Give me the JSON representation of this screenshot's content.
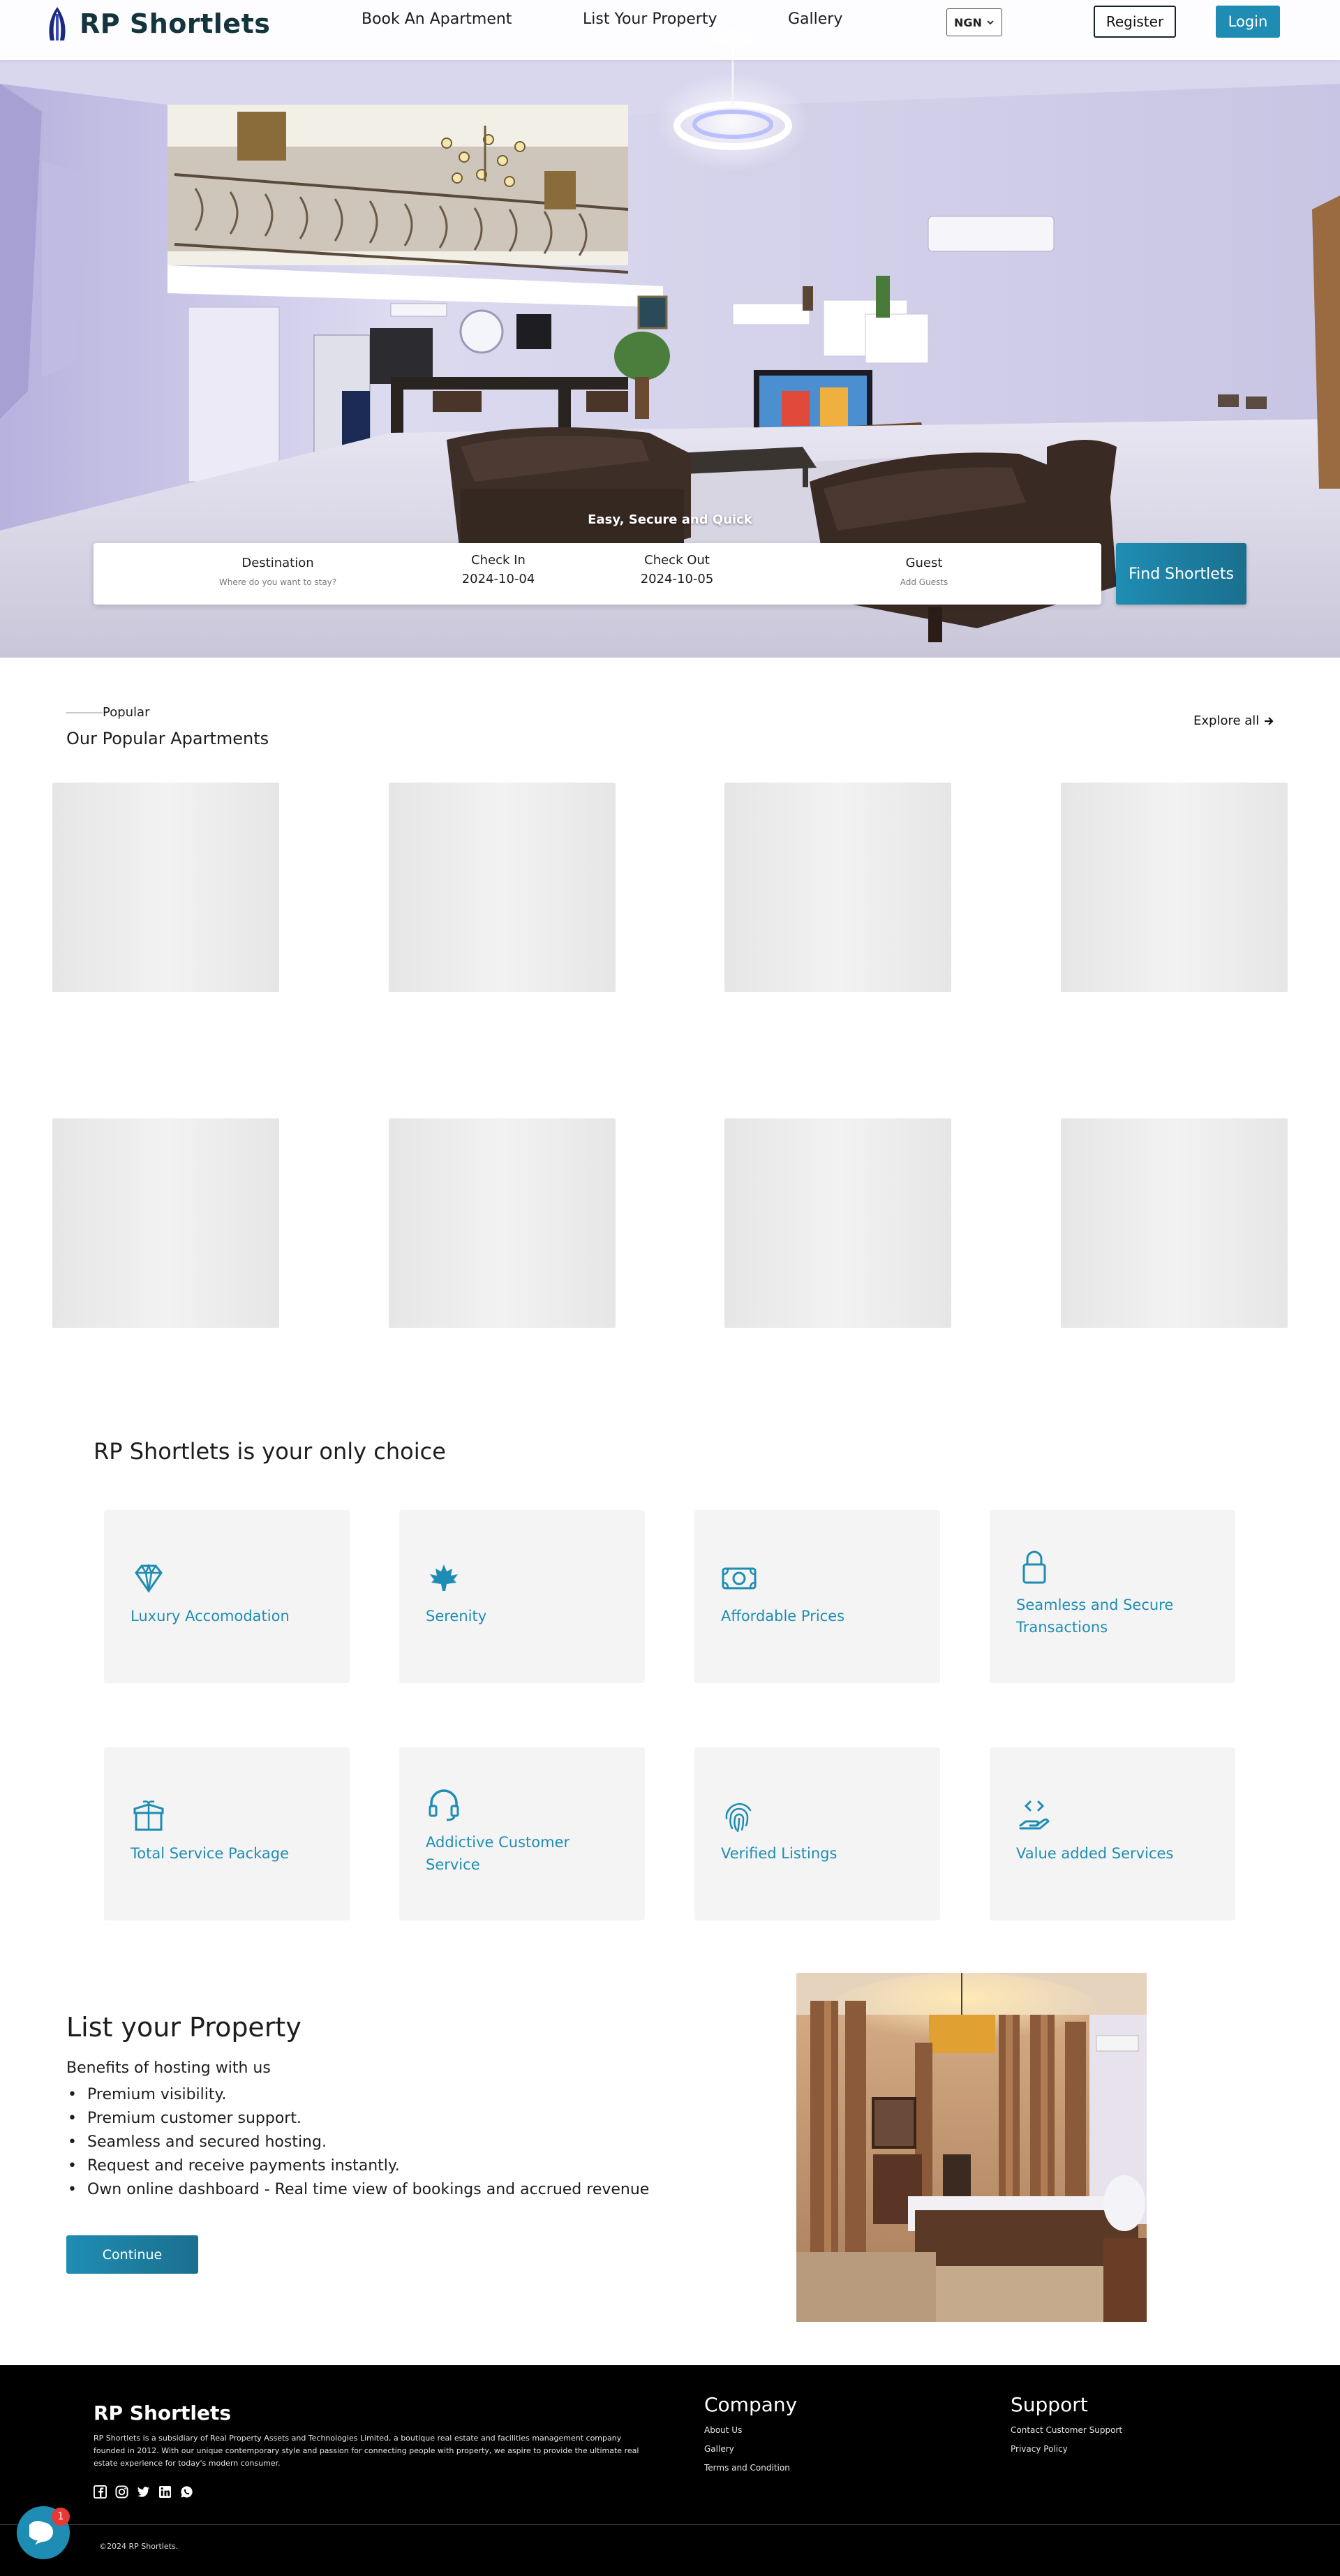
{
  "header": {
    "brand": "RP Shortlets",
    "nav": {
      "book": "Book An Apartment",
      "list": "List Your Property",
      "gallery": "Gallery"
    },
    "currency": "NGN",
    "register": "Register",
    "login": "Login"
  },
  "hero": {
    "tagline": "Easy, Secure and Quick",
    "search": {
      "destination_label": "Destination",
      "destination_placeholder": "Where do you want to stay?",
      "checkin_label": "Check In",
      "checkin_value": "2024-10-04",
      "checkout_label": "Check Out",
      "checkout_value": "2024-10-05",
      "guest_label": "Guest",
      "guest_placeholder": "Add Guests"
    },
    "find_button": "Find Shortlets"
  },
  "popular": {
    "eyebrow": "Popular",
    "title": "Our Popular Apartments",
    "explore": "Explore all"
  },
  "choice": {
    "title": "RP Shortlets is your only choice",
    "features": [
      {
        "label": "Luxury Accomodation",
        "icon": "diamond-icon"
      },
      {
        "label": "Serenity",
        "icon": "maple-leaf-icon"
      },
      {
        "label": "Affordable Prices",
        "icon": "money-bill-icon"
      },
      {
        "label": "Seamless and Secure Transactions",
        "icon": "lock-icon"
      },
      {
        "label": "Total Service Package",
        "icon": "gift-box-icon"
      },
      {
        "label": "Addictive Customer Service",
        "icon": "headset-icon"
      },
      {
        "label": "Verified Listings",
        "icon": "fingerprint-icon"
      },
      {
        "label": "Value added Services",
        "icon": "hand-code-icon"
      }
    ]
  },
  "list_property": {
    "title": "List your Property",
    "subtitle": "Benefits of hosting with us",
    "benefits": [
      "Premium visibility.",
      "Premium customer support.",
      "Seamless and secured hosting.",
      "Request and receive payments instantly.",
      "Own online dashboard - Real time view of bookings and accrued revenue"
    ],
    "continue": "Continue"
  },
  "footer": {
    "brand": "RP Shortlets",
    "about": "RP Shortlets is a subsidiary of Real Property Assets and Technologies Limited, a boutique real estate and facilities management company founded in 2012. With our unique contemporary style and passion for connecting people with property, we aspire to provide the ultimate real estate experience for today's modern consumer.",
    "company_title": "Company",
    "company_links": [
      "About Us",
      "Gallery",
      "Terms and Condition"
    ],
    "support_title": "Support",
    "support_links": [
      "Contact Customer Support",
      "Privacy Policy"
    ],
    "copyright": "©2024 RP Shortlets.",
    "social_icons": [
      "facebook-icon",
      "instagram-icon",
      "twitter-icon",
      "linkedin-icon",
      "whatsapp-icon"
    ]
  },
  "chat": {
    "badge": "1"
  },
  "colors": {
    "accent": "#1f8db3",
    "brand_dark": "#14343e",
    "footer_bg": "#000000",
    "card_bg": "#f4f4f4"
  }
}
